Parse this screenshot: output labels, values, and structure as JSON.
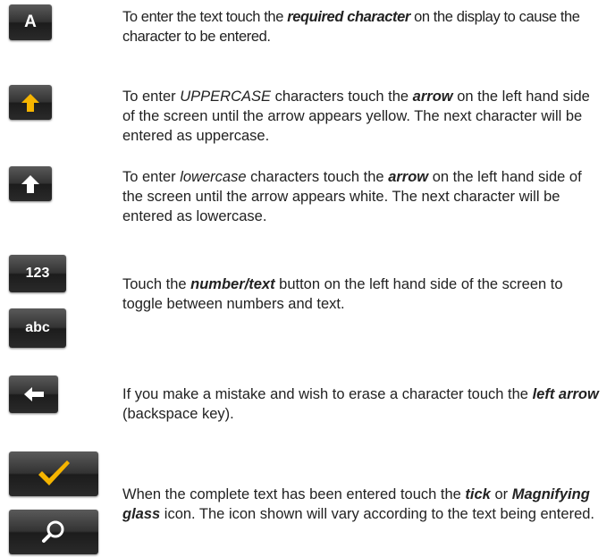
{
  "keys": {
    "letter_key": "A",
    "numbers_key": "123",
    "text_key": "abc"
  },
  "colors": {
    "key_gradient": "#333333",
    "uppercase_arrow": "#f5b400",
    "tick": "#f5b400",
    "magnifier": "#ffffff"
  },
  "icons": [
    "letter-a-icon",
    "up-arrow-yellow-icon",
    "up-arrow-white-icon",
    "numbers-icon",
    "text-icon",
    "left-arrow-icon",
    "tick-icon",
    "magnifying-glass-icon"
  ],
  "instructions": {
    "enter_text": {
      "t1": "To enter the text touch the ",
      "b1": "required character",
      "t2": " on the display to cause the character to be entered."
    },
    "uppercase": {
      "t1": "To enter ",
      "i1": "UPPERCASE",
      "t2": " characters touch the ",
      "b1": "arrow",
      "t3": " on the left hand side of the screen until the arrow appears yellow. The next character will be entered as uppercase."
    },
    "lowercase": {
      "t1": "To enter ",
      "i1": "lowercase",
      "t2": " characters touch the ",
      "b1": "arrow",
      "t3": " on the left hand side of the screen until the arrow appears white. The next character will be entered as lowercase."
    },
    "toggle": {
      "t1": "Touch the ",
      "b1": "number/text",
      "t2": " button on the left hand side of the screen to toggle between numbers and text."
    },
    "backspace": {
      "t1": "If you make a mistake and wish to erase a character touch the ",
      "b1": "left arrow",
      "t2": " (backspace key)."
    },
    "complete": {
      "t1": "When the complete text has been entered touch the ",
      "b1": "tick",
      "t2": " or ",
      "b2": "Magnifying glass",
      "t3": " icon. The icon shown will vary according to the text being entered."
    }
  }
}
